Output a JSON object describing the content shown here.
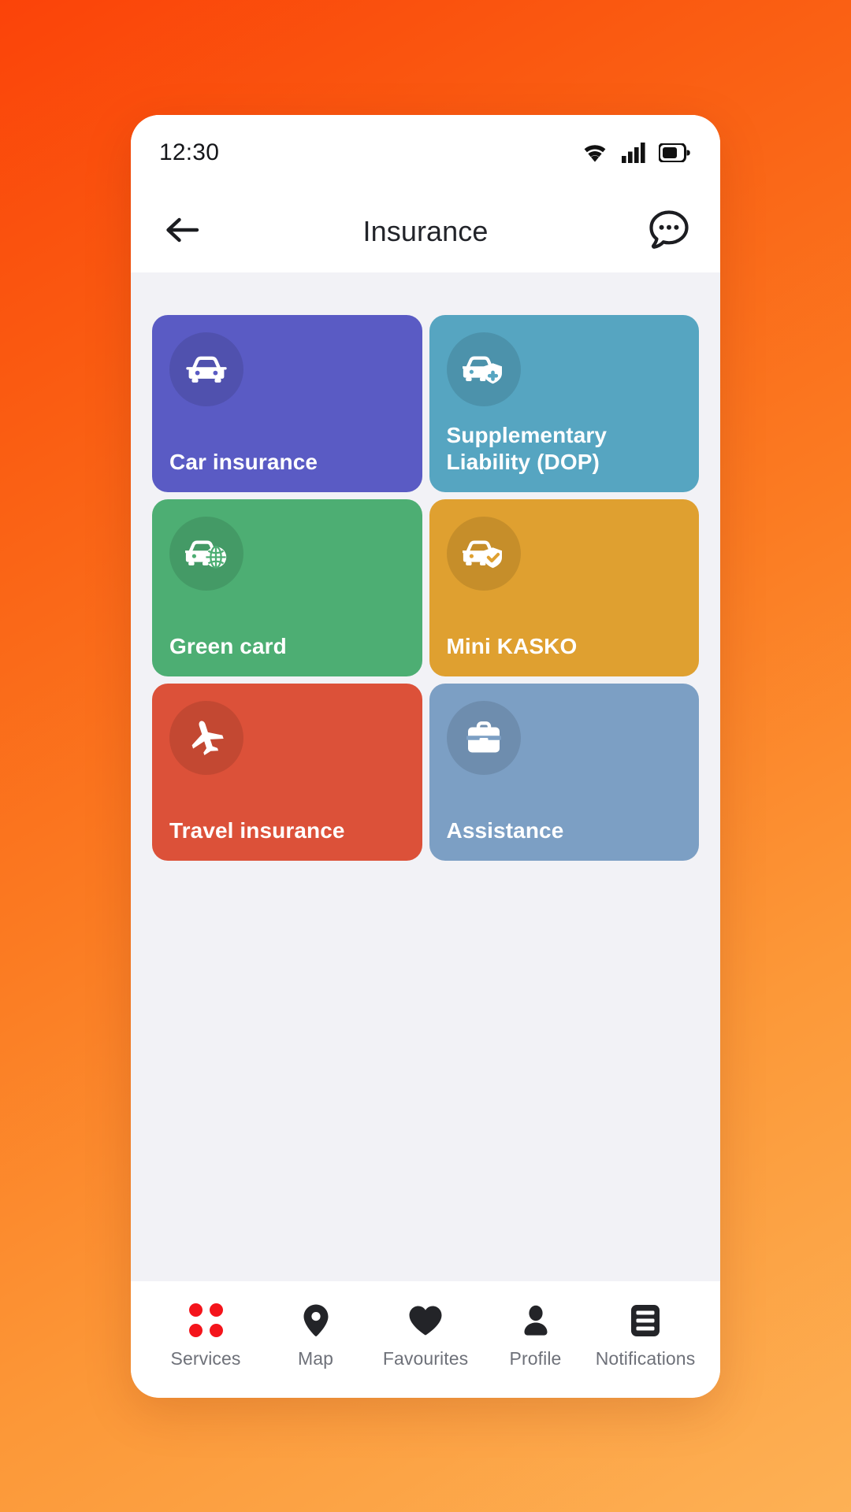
{
  "status_bar": {
    "time": "12:30",
    "icons": [
      "wifi-icon",
      "cellular-signal-icon",
      "battery-icon"
    ]
  },
  "header": {
    "back_icon": "arrow-left-icon",
    "title": "Insurance",
    "chat_icon": "chat-bubble-dots-icon"
  },
  "theme": {
    "background_gradient_from": "#FB4309",
    "background_gradient_to": "#FDB155",
    "content_background": "#F2F2F6",
    "phone_background": "#FFFFFF",
    "accent_red": "#F4141B",
    "nav_label_color": "#6E7179",
    "title_color": "#22242A"
  },
  "main": {
    "tiles": [
      {
        "label": "Car insurance",
        "color": "#5A5BC4",
        "icon": "car-front-icon"
      },
      {
        "label": "Supplementary\nLiability (DOP)",
        "color": "#56A5C1",
        "icon": "car-shield-plus-icon"
      },
      {
        "label": "Green card",
        "color": "#4DAE73",
        "icon": "car-globe-icon"
      },
      {
        "label": "Mini KASKO",
        "color": "#DFA030",
        "icon": "car-shield-check-icon"
      },
      {
        "label": "Travel insurance",
        "color": "#DC5139",
        "icon": "airplane-icon"
      },
      {
        "label": "Assistance",
        "color": "#7C9FC4",
        "icon": "briefcase-icon"
      }
    ]
  },
  "bottom_nav": {
    "items": [
      {
        "label": "Services",
        "icon": "four-dots-icon"
      },
      {
        "label": "Map",
        "icon": "map-pin-icon"
      },
      {
        "label": "Favourites",
        "icon": "heart-icon"
      },
      {
        "label": "Profile",
        "icon": "person-icon"
      },
      {
        "label": "Notifications",
        "icon": "list-box-icon"
      }
    ]
  }
}
